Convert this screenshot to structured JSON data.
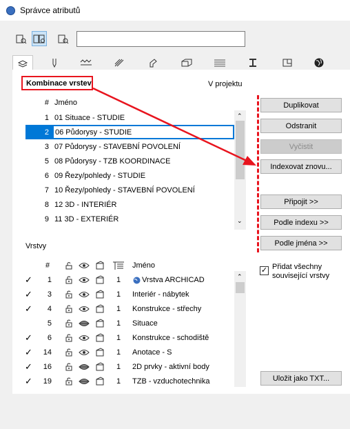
{
  "window": {
    "title": "Správce atributů"
  },
  "view_buttons": [
    {
      "name": "single-view",
      "selected": false
    },
    {
      "name": "compare-view",
      "selected": true
    },
    {
      "name": "single-view-right",
      "selected": false
    }
  ],
  "search": {
    "value": ""
  },
  "tabs": [
    "layers-icon",
    "pen-icon",
    "line-icon",
    "fill-icon",
    "surface-icon",
    "composite-icon",
    "profile-icon",
    "zone-icon",
    "mep-icon",
    "globe-icon"
  ],
  "combinations": {
    "section_label": "Kombinace vrstev",
    "project_label": "V projektu",
    "header_num": "#",
    "header_name": "Jméno",
    "rows": [
      {
        "num": "1",
        "name": "01 Situace - STUDIE"
      },
      {
        "num": "2",
        "name": "06 Půdorysy - STUDIE",
        "selected": true
      },
      {
        "num": "3",
        "name": "07 Půdorysy - STAVEBNÍ POVOLENÍ"
      },
      {
        "num": "5",
        "name": "08 Půdorysy - TZB KOORDINACE"
      },
      {
        "num": "6",
        "name": "09 Řezy/pohledy - STUDIE"
      },
      {
        "num": "7",
        "name": "10 Řezy/pohledy - STAVEBNÍ POVOLENÍ"
      },
      {
        "num": "8",
        "name": "12 3D - INTERIÉR"
      },
      {
        "num": "9",
        "name": "11 3D - EXTERIÉR"
      }
    ]
  },
  "buttons": {
    "duplicate": "Duplikovat",
    "remove": "Odstranit",
    "clean": "Vyčistit",
    "reindex": "Indexovat znovu...",
    "attach": "Připojit >>",
    "by_index": "Podle indexu >>",
    "by_name": "Podle jména >>",
    "save_txt": "Uložit jako TXT..."
  },
  "layers": {
    "section_label": "Vrstvy",
    "header_num": "#",
    "header_name": "Jméno",
    "add_related_label": "Přidat všechny související vrstvy",
    "add_related_checked": true,
    "rows": [
      {
        "check": true,
        "num": "1",
        "visible": true,
        "pen": "1",
        "name": "Vrstva ARCHICAD",
        "globe": true
      },
      {
        "check": true,
        "num": "3",
        "visible": true,
        "pen": "1",
        "name": "Interiér - nábytek"
      },
      {
        "check": true,
        "num": "4",
        "visible": true,
        "pen": "1",
        "name": "Konstrukce - střechy"
      },
      {
        "check": false,
        "num": "5",
        "visible": false,
        "pen": "1",
        "name": "Situace"
      },
      {
        "check": true,
        "num": "6",
        "visible": true,
        "pen": "1",
        "name": "Konstrukce - schodiště"
      },
      {
        "check": true,
        "num": "14",
        "visible": true,
        "pen": "1",
        "name": "Anotace - S"
      },
      {
        "check": true,
        "num": "16",
        "visible": false,
        "pen": "1",
        "name": "2D prvky - aktivní body"
      },
      {
        "check": true,
        "num": "19",
        "visible": false,
        "pen": "1",
        "name": "TZB - vzduchotechnika"
      }
    ]
  },
  "colors": {
    "annotation_red": "#e8141e",
    "selection_blue": "#0078d7"
  }
}
